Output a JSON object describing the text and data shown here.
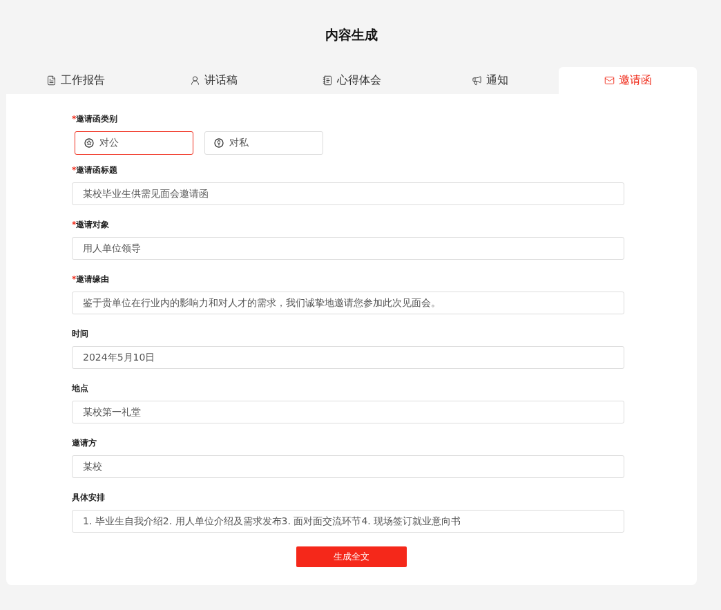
{
  "title": "内容生成",
  "tabs": [
    {
      "label": "工作报告",
      "selected": false
    },
    {
      "label": "讲话稿",
      "selected": false
    },
    {
      "label": "心得体会",
      "selected": false
    },
    {
      "label": "通知",
      "selected": false
    },
    {
      "label": "邀请函",
      "selected": true
    }
  ],
  "category": {
    "asterisk": "*",
    "label": "邀请函类别",
    "options": [
      {
        "label": "对公",
        "selected": true
      },
      {
        "label": "对私",
        "selected": false
      }
    ]
  },
  "fields": [
    {
      "asterisk": "*",
      "label": "邀请函标题",
      "value": "某校毕业生供需见面会邀请函"
    },
    {
      "asterisk": "*",
      "label": "邀请对象",
      "value": "用人单位领导"
    },
    {
      "asterisk": "*",
      "label": "邀请缘由",
      "value": "鉴于贵单位在行业内的影响力和对人才的需求，我们诚挚地邀请您参加此次见面会。"
    },
    {
      "label": "时间",
      "value": "2024年5月10日"
    },
    {
      "label": "地点",
      "value": "某校第一礼堂"
    },
    {
      "label": "邀请方",
      "value": "某校"
    },
    {
      "label": "具体安排",
      "value": "1. 毕业生自我介绍2. 用人单位介绍及需求发布3. 面对面交流环节4. 现场签订就业意向书"
    }
  ],
  "submit": "生成全文"
}
